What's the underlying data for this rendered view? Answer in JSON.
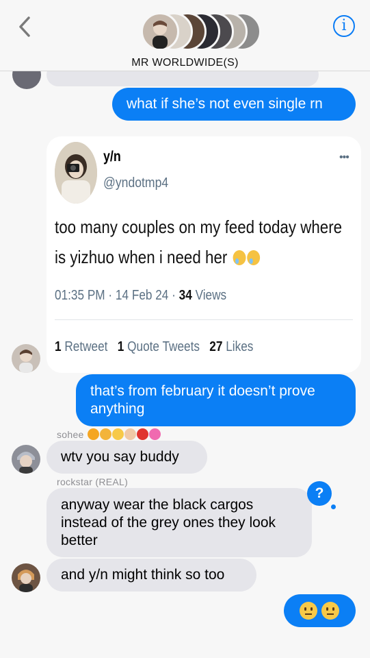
{
  "header": {
    "group_name": "MR WORLDWIDE(S)"
  },
  "messages": {
    "sent_1": "what if she’s not even single rn",
    "sent_2": "that’s from february it doesn’t prove anything",
    "sohee_name": "sohee",
    "recv_1": "wtv you say buddy",
    "rockstar_name": "rockstar (REAL)",
    "recv_2": "anyway wear the black cargos instead of the grey ones they look better",
    "recv_3": "and y/n might think so too",
    "question_badge": "?"
  },
  "tweet": {
    "name": "y/n",
    "handle": "@yndotmp4",
    "more": "•••",
    "text_line1": "too many couples on my feed today where",
    "text_line2": "is yizhuo when i need her",
    "time": "01:35 PM · 14 Feb 24 · ",
    "views_count": "34",
    "views_label": " Views",
    "retweets_count": "1",
    "retweets_label": " Retweet",
    "quotes_count": "1",
    "quotes_label": " Quote Tweets",
    "likes_count": "27",
    "likes_label": " Likes"
  },
  "colors": {
    "accent": "#0b7ff5",
    "received_bubble": "#e5e5ea"
  }
}
